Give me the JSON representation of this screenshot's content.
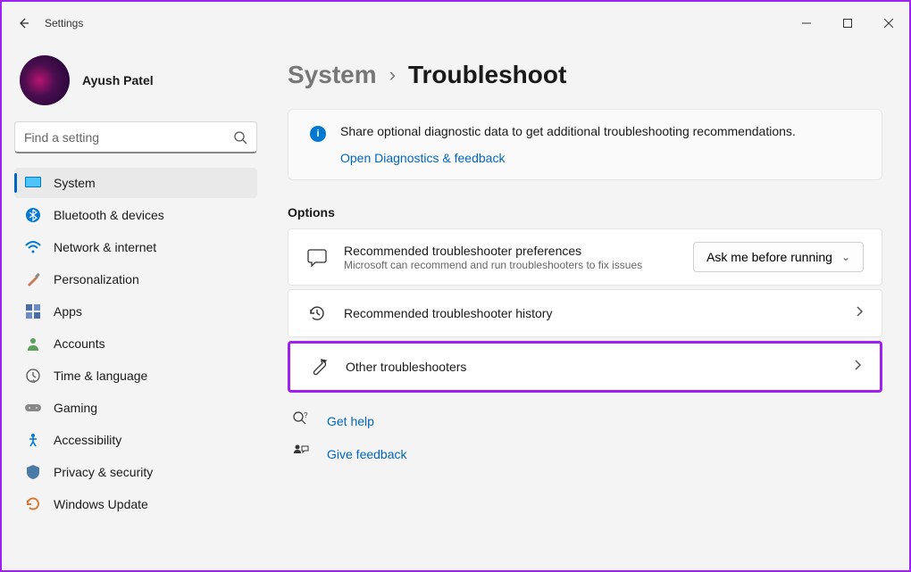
{
  "app": {
    "title": "Settings"
  },
  "user": {
    "name": "Ayush Patel"
  },
  "search": {
    "placeholder": "Find a setting"
  },
  "nav": {
    "items": [
      {
        "label": "System",
        "icon": "system"
      },
      {
        "label": "Bluetooth & devices",
        "icon": "bluetooth"
      },
      {
        "label": "Network & internet",
        "icon": "wifi"
      },
      {
        "label": "Personalization",
        "icon": "brush"
      },
      {
        "label": "Apps",
        "icon": "apps"
      },
      {
        "label": "Accounts",
        "icon": "person"
      },
      {
        "label": "Time & language",
        "icon": "clock"
      },
      {
        "label": "Gaming",
        "icon": "gaming"
      },
      {
        "label": "Accessibility",
        "icon": "accessibility"
      },
      {
        "label": "Privacy & security",
        "icon": "shield"
      },
      {
        "label": "Windows Update",
        "icon": "update"
      }
    ]
  },
  "breadcrumb": {
    "parent": "System",
    "current": "Troubleshoot"
  },
  "info": {
    "text": "Share optional diagnostic data to get additional troubleshooting recommendations.",
    "link": "Open Diagnostics & feedback"
  },
  "options": {
    "heading": "Options",
    "row1": {
      "title": "Recommended troubleshooter preferences",
      "sub": "Microsoft can recommend and run troubleshooters to fix issues",
      "dropdown": "Ask me before running"
    },
    "row2": {
      "title": "Recommended troubleshooter history"
    },
    "row3": {
      "title": "Other troubleshooters"
    }
  },
  "footer": {
    "help": "Get help",
    "feedback": "Give feedback"
  }
}
